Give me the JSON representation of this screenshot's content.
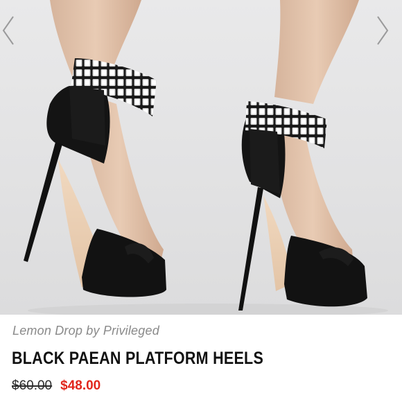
{
  "listing": {
    "brand": "Lemon Drop by Privileged",
    "title": "BLACK PAEAN PLATFORM HEELS",
    "original_price": "$60.00",
    "sale_price": "$48.00"
  },
  "carousel": {
    "prev_icon": "chevron-left-icon",
    "next_icon": "chevron-right-icon"
  },
  "colors": {
    "sale_price": "#e1261c",
    "brand_text": "#8a8a8a",
    "title_text": "#111111"
  }
}
